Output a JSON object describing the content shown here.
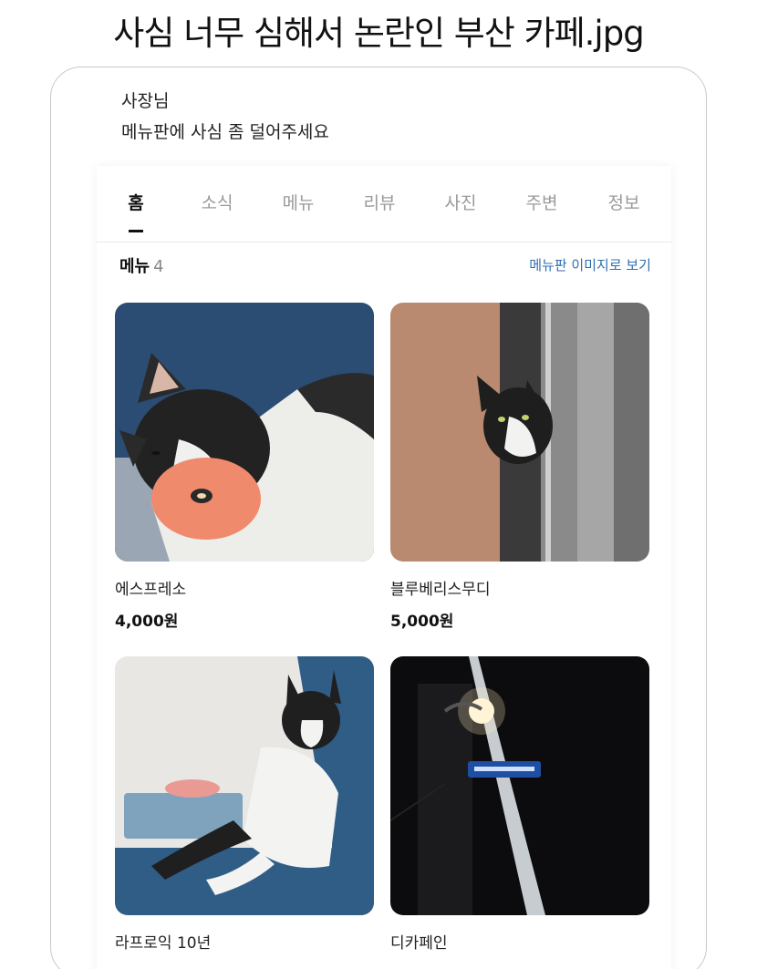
{
  "headline": "사심 너무 심해서 논란인 부산 카페.jpg",
  "message": {
    "line1": "사장님",
    "line2": "메뉴판에 사심 좀 덜어주세요"
  },
  "tabs": [
    {
      "label": "홈",
      "active": true
    },
    {
      "label": "소식",
      "active": false
    },
    {
      "label": "메뉴",
      "active": false
    },
    {
      "label": "리뷰",
      "active": false
    },
    {
      "label": "사진",
      "active": false
    },
    {
      "label": "주변",
      "active": false
    },
    {
      "label": "정보",
      "active": false
    }
  ],
  "menu_section": {
    "title": "메뉴",
    "count": "4",
    "image_link": "메뉴판 이미지로 보기"
  },
  "items": [
    {
      "name": "에스프레소",
      "price": "4,000원"
    },
    {
      "name": "블루베리스무디",
      "price": "5,000원"
    },
    {
      "name": "라프로익 10년",
      "price": ""
    },
    {
      "name": "디카페인",
      "price": ""
    }
  ],
  "colors": {
    "link": "#2f6fb0",
    "inactive_tab": "#9a9a9a",
    "card_border": "#c9c9c9"
  }
}
